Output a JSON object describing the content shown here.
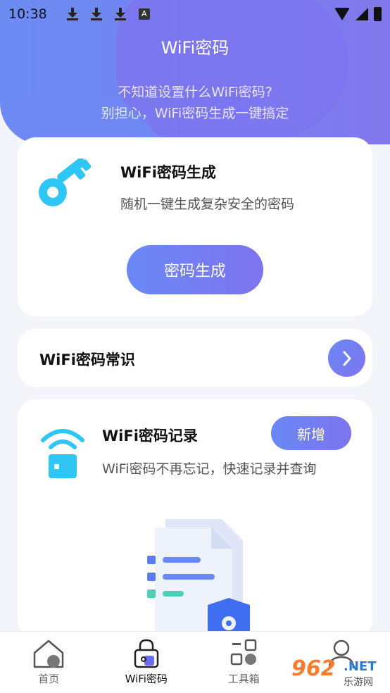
{
  "status_bar": {
    "time": "10:38",
    "icons": [
      "download-icon",
      "download-icon",
      "download-icon",
      "a-notification-icon",
      "wifi-signal-icon",
      "cell-signal-icon",
      "battery-icon"
    ]
  },
  "header": {
    "title": "WiFi密码",
    "subtitle_line1": "不知道设置什么WiFi密码?",
    "subtitle_line2": "别担心，WiFi密码生成一键搞定"
  },
  "generator_card": {
    "icon": "key-icon",
    "title": "WiFi密码生成",
    "description": "随机一键生成复杂安全的密码",
    "button_label": "密码生成"
  },
  "knowledge_card": {
    "title": "WiFi密码常识",
    "arrow_icon": "chevron-right-icon"
  },
  "records_card": {
    "icon": "router-icon",
    "title": "WiFi密码记录",
    "description": "WiFi密码不再忘记，快速记录并查询",
    "add_button_label": "新增",
    "illustration": "document-shield-illustration"
  },
  "tab_bar": {
    "tabs": [
      {
        "label": "首页",
        "icon": "home-icon",
        "active": false
      },
      {
        "label": "WiFi密码",
        "icon": "lock-icon",
        "active": true
      },
      {
        "label": "工具箱",
        "icon": "toolbox-icon",
        "active": false
      },
      {
        "label": "",
        "icon": "profile-icon",
        "active": false
      }
    ]
  },
  "watermark": {
    "main": "962",
    "net": ".NET",
    "sub": "乐游网"
  },
  "colors": {
    "accent_start": "#6a88f5",
    "accent_end": "#7d74ee",
    "icon_cyan": "#2ec6f5",
    "background": "#f4f5fa"
  }
}
